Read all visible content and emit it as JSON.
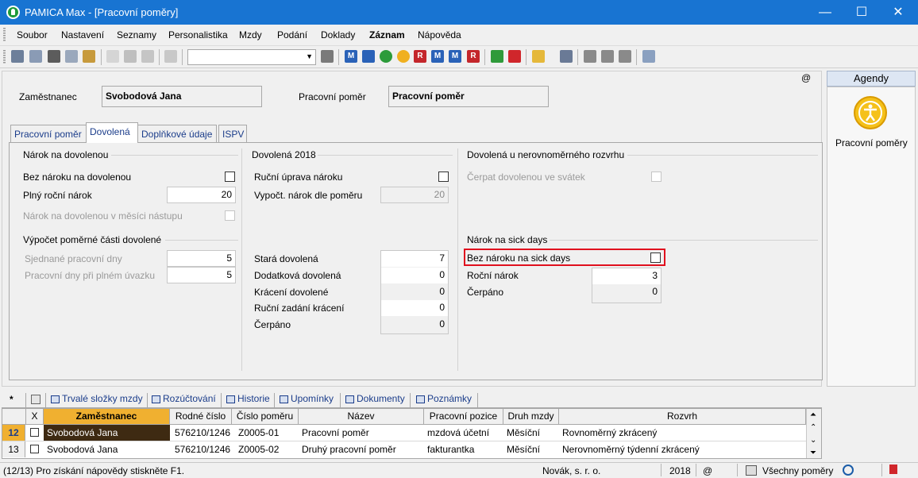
{
  "window": {
    "title": "PAMICA Max - [Pracovní poměry]",
    "minimize": "—",
    "maximize": "☐",
    "close": "✕"
  },
  "menu": [
    "Soubor",
    "Nastavení",
    "Seznamy",
    "Personalistika",
    "Mzdy",
    "Podání",
    "Doklady",
    "Záznam",
    "Nápověda"
  ],
  "toolbar": {
    "combo_value": "",
    "m_label": "M",
    "r_label": "R"
  },
  "header": {
    "employee_label": "Zaměstnanec",
    "employee_value": "Svobodová Jana",
    "relation_label": "Pracovní poměr",
    "relation_value": "Pracovní poměr",
    "at_sign": "@"
  },
  "tabs": [
    "Pracovní poměr",
    "Dovolená",
    "Doplňkové údaje",
    "ISPV"
  ],
  "col1": {
    "title": "Nárok na dovolenou",
    "no_claim": "Bez nároku na dovolenou",
    "full_claim": "Plný roční nárok",
    "full_claim_value": "20",
    "claim_month": "Nárok na dovolenou v měsíci nástupu",
    "title2": "Výpočet poměrné části dovolené",
    "agreed_days": "Sjednané pracovní dny",
    "agreed_days_value": "5",
    "full_days": "Pracovní dny při plném úvazku",
    "full_days_value": "5"
  },
  "col2": {
    "title": "Dovolená 2018",
    "manual": "Ruční úprava nároku",
    "computed": "Vypočt. nárok dle poměru",
    "computed_value": "20",
    "old": "Stará dovolená",
    "old_value": "7",
    "extra": "Dodatková dovolená",
    "extra_value": "0",
    "reduction": "Krácení dovolené",
    "reduction_value": "0",
    "manual_reduction": "Ruční zadání krácení",
    "manual_reduction_value": "0",
    "used": "Čerpáno",
    "used_value": "0"
  },
  "col3": {
    "title": "Dovolená u nerovnoměrného rozvrhu",
    "holiday": "Čerpat dovolenou ve svátek",
    "title2": "Nárok na sick days",
    "no_sick": "Bez nároku na sick days",
    "annual": "Roční nárok",
    "annual_value": "3",
    "used": "Čerpáno",
    "used_value": "0"
  },
  "agenda": {
    "header": "Agendy",
    "item": "Pracovní poměry"
  },
  "bottom_tabs": {
    "star": "*",
    "items": [
      "Trvalé složky mzdy",
      "Rozúčtování",
      "Historie",
      "Upomínky",
      "Dokumenty",
      "Poznámky"
    ]
  },
  "grid": {
    "headers": [
      "X",
      "Zaměstnanec",
      "Rodné číslo",
      "Číslo poměru",
      "Název",
      "Pracovní pozice",
      "Druh mzdy",
      "Rozvrh"
    ],
    "rows": [
      {
        "num": "12",
        "name": "Svobodová Jana",
        "rc": "576210/1246",
        "no": "Z0005-01",
        "title": "Pracovní poměr",
        "position": "mzdová účetní",
        "wage": "Měsíční",
        "schedule": "Rovnoměrný zkrácený"
      },
      {
        "num": "13",
        "name": "Svobodová Jana",
        "rc": "576210/1246",
        "no": "Z0005-02",
        "title": "Druhý pracovní poměr",
        "position": "fakturantka",
        "wage": "Měsíční",
        "schedule": "Nerovnoměrný týdenní zkrácený"
      }
    ]
  },
  "status": {
    "help": "(12/13) Pro získání nápovědy stiskněte F1.",
    "company": "Novák, s. r. o.",
    "year": "2018",
    "at": "@",
    "filter": "Všechny poměry"
  },
  "colors": {
    "titlebar": "#1874d2",
    "highlight": "#e0101e",
    "sort_header": "#f0b030"
  }
}
